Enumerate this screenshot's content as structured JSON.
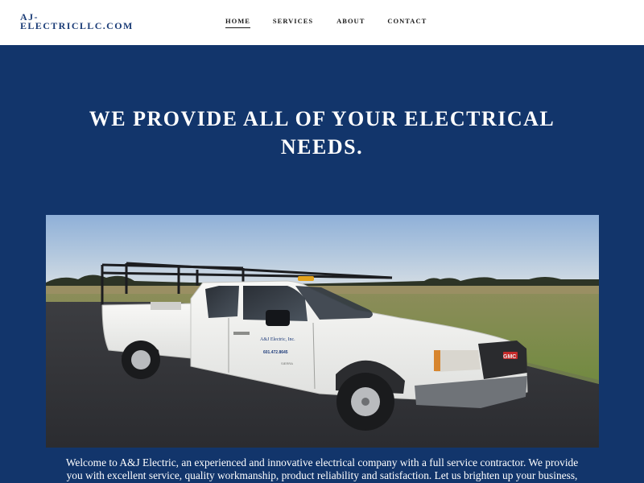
{
  "header": {
    "logo_line1": "AJ-",
    "logo_line2": "ELECTRICLLC.COM",
    "nav": [
      {
        "label": "HOME",
        "active": true
      },
      {
        "label": "SERVICES",
        "active": false
      },
      {
        "label": "ABOUT",
        "active": false
      },
      {
        "label": "CONTACT",
        "active": false
      }
    ]
  },
  "hero": {
    "headline_line1": "WE PROVIDE ALL OF YOUR ELECTRICAL",
    "headline_line2": "NEEDS.",
    "photo_alt": "White pickup truck with ladder rack parked on pavement beside a grassy field",
    "truck_door_text": "A&J Electric, Inc.",
    "truck_door_phone": "601.472.8645",
    "truck_brand": "GMC",
    "truck_badge": "SIERRA"
  },
  "intro": {
    "text_line1": "Welcome to A&J Electric, an experienced and innovative electrical company with a full service contractor. We provide",
    "text_line2": "you with excellent service, quality workmanship, product reliability and satisfaction. Let us brighten up your business,"
  },
  "colors": {
    "background": "#12356b",
    "header_bg": "#ffffff",
    "logo": "#1d3e78",
    "text_light": "#ffffff"
  }
}
